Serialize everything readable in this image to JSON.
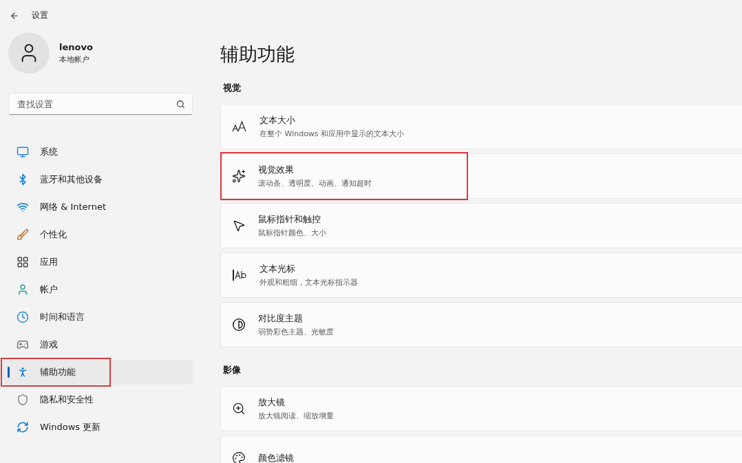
{
  "window": {
    "title": "设置"
  },
  "account": {
    "name": "lenovo",
    "type": "本地帐户"
  },
  "search": {
    "placeholder": "查找设置"
  },
  "sidebar": {
    "items": [
      {
        "label": "系统",
        "selected": false,
        "highlighted": false
      },
      {
        "label": "蓝牙和其他设备",
        "selected": false,
        "highlighted": false
      },
      {
        "label": "网络 & Internet",
        "selected": false,
        "highlighted": false
      },
      {
        "label": "个性化",
        "selected": false,
        "highlighted": false
      },
      {
        "label": "应用",
        "selected": false,
        "highlighted": false
      },
      {
        "label": "帐户",
        "selected": false,
        "highlighted": false
      },
      {
        "label": "时间和语言",
        "selected": false,
        "highlighted": false
      },
      {
        "label": "游戏",
        "selected": false,
        "highlighted": false
      },
      {
        "label": "辅助功能",
        "selected": true,
        "highlighted": true
      },
      {
        "label": "隐私和安全性",
        "selected": false,
        "highlighted": false
      },
      {
        "label": "Windows 更新",
        "selected": false,
        "highlighted": false
      }
    ]
  },
  "page_title": "辅助功能",
  "sections": [
    {
      "heading": "视觉",
      "items": [
        {
          "title": "文本大小",
          "subtitle": "在整个 Windows 和应用中显示的文本大小",
          "highlighted": false
        },
        {
          "title": "视觉效果",
          "subtitle": "滚动条、透明度、动画、通知超时",
          "highlighted": true
        },
        {
          "title": "鼠标指针和触控",
          "subtitle": "鼠标指针颜色、大小",
          "highlighted": false
        },
        {
          "title": "文本光标",
          "subtitle": "外观和粗细，文本光标指示器",
          "highlighted": false
        },
        {
          "title": "对比度主题",
          "subtitle": "弱势彩色主题、光敏度",
          "highlighted": false
        }
      ]
    },
    {
      "heading": "影像",
      "items": [
        {
          "title": "放大镜",
          "subtitle": "放大镜阅读、缩放增量",
          "highlighted": false
        },
        {
          "title": "颜色滤镜",
          "highlighted": false
        }
      ]
    }
  ]
}
